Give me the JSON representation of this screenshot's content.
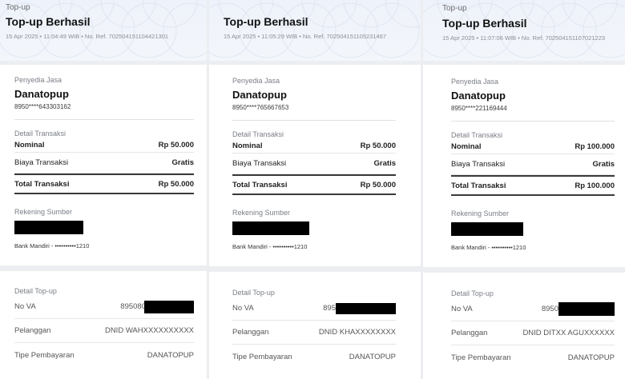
{
  "receipts": [
    {
      "kicker": "Top-up",
      "title": "Top-up Berhasil",
      "meta": "15 Apr 2025 • 11:04:49 WIB • No. Ref. 702504151104421301",
      "provider_label": "Penyedia Jasa",
      "provider_name": "Danatopup",
      "provider_number": "8950****643303162",
      "detail_label": "Detail Transaksi",
      "nominal_label": "Nominal",
      "nominal_value": "Rp 50.000",
      "fee_label": "Biaya Transaksi",
      "fee_value": "Gratis",
      "total_label": "Total Transaksi",
      "total_value": "Rp 50.000",
      "source_label": "Rekening Sumber",
      "bank": "Bank Mandiri - ••••••••••1210",
      "topup_label": "Detail Top-up",
      "va_label": "No VA",
      "va_visible": "895080",
      "customer_label": "Pelanggan",
      "customer_value": "DNID WAHXXXXXXXXXX",
      "paytype_label": "Tipe Pembayaran",
      "paytype_value": "DANATOPUP"
    },
    {
      "kicker": "",
      "title": "Top-up Berhasil",
      "meta": "15 Apr 2025 • 11:05:29 WIB • No. Ref. 702504151105231467",
      "provider_label": "Penyedia Jasa",
      "provider_name": "Danatopup",
      "provider_number": "8950****765667653",
      "detail_label": "Detail Transaksi",
      "nominal_label": "Nominal",
      "nominal_value": "Rp 50.000",
      "fee_label": "Biaya Transaksi",
      "fee_value": "Gratis",
      "total_label": "Total Transaksi",
      "total_value": "Rp 50.000",
      "source_label": "Rekening Sumber",
      "bank": "Bank Mandiri - ••••••••••1210",
      "topup_label": "Detail Top-up",
      "va_label": "No VA",
      "va_visible": "895",
      "customer_label": "Pelanggan",
      "customer_value": "DNID KHAXXXXXXXX",
      "paytype_label": "Tipe Pembayaran",
      "paytype_value": "DANATOPUP"
    },
    {
      "kicker": "Top-up",
      "title": "Top-up Berhasil",
      "meta": "15 Apr 2025 • 11:07:06 WIB • No. Ref. 702504151107021223",
      "provider_label": "Penyedia Jasa",
      "provider_name": "Danatopup",
      "provider_number": "8950****221169444",
      "detail_label": "Detail Transaksi",
      "nominal_label": "Nominal",
      "nominal_value": "Rp 100.000",
      "fee_label": "Biaya Transaksi",
      "fee_value": "Gratis",
      "total_label": "Total Transaksi",
      "total_value": "Rp 100.000",
      "source_label": "Rekening Sumber",
      "bank": "Bank Mandiri - ••••••••••1210",
      "topup_label": "Detail Top-up",
      "va_label": "No VA",
      "va_visible": "8950",
      "customer_label": "Pelanggan",
      "customer_value": "DNID DITXX AGUXXXXXX",
      "paytype_label": "Tipe Pembayaran",
      "paytype_value": "DANATOPUP"
    }
  ]
}
